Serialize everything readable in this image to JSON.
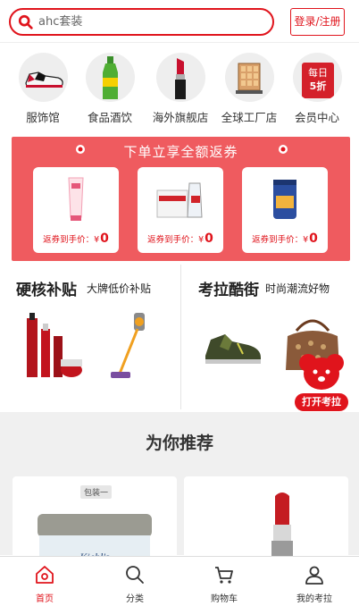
{
  "header": {
    "search_text": "ahc套装",
    "login_label": "登录/注册"
  },
  "categories": [
    {
      "label": "服饰馆",
      "icon": "sneaker-icon"
    },
    {
      "label": "食品酒饮",
      "icon": "green-bottle-icon"
    },
    {
      "label": "海外旗舰店",
      "icon": "lipstick-icon"
    },
    {
      "label": "全球工厂店",
      "icon": "factory-box-icon"
    },
    {
      "label": "会员中心",
      "icon": "member-tag-icon",
      "badge_line1": "每日",
      "badge_line2": "5折"
    }
  ],
  "banner": {
    "title": "下单立享全额返券",
    "items": [
      {
        "price_label": "返券到手价：¥",
        "price_value": "0",
        "product": "ponds-cleanser-tube"
      },
      {
        "price_label": "返券到手价：¥",
        "price_value": "0",
        "product": "water-box"
      },
      {
        "price_label": "返券到手价：¥",
        "price_value": "0",
        "product": "snack-can"
      }
    ]
  },
  "promo": {
    "left": {
      "title": "硬核补贴",
      "subtitle": "大牌低价补贴"
    },
    "right": {
      "title": "考拉酷街",
      "subtitle": "时尚潮流好物"
    },
    "open_app_label": "打开考拉"
  },
  "recommend": {
    "title": "为你推荐",
    "cards": [
      {
        "tag": "包装一",
        "product": "kiehls-cream-jar"
      },
      {
        "tag": "",
        "product": "lipstick"
      }
    ]
  },
  "nav": {
    "items": [
      {
        "label": "首页",
        "icon": "home-icon",
        "active": true
      },
      {
        "label": "分类",
        "icon": "search-icon",
        "active": false
      },
      {
        "label": "购物车",
        "icon": "cart-icon",
        "active": false
      },
      {
        "label": "我的考拉",
        "icon": "user-icon",
        "active": false
      }
    ]
  },
  "colors": {
    "accent": "#e0141c",
    "banner_bg": "#ef5b5f",
    "section_bg": "#f0f0f0"
  }
}
